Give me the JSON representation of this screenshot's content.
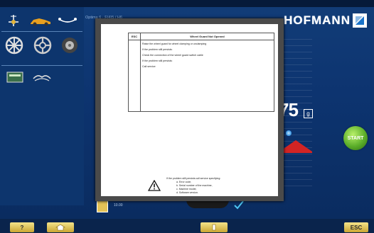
{
  "app": {
    "title_small": "Optima 6 · F(4)5 / H6",
    "brand": "HOFMANN"
  },
  "toolbar": {
    "icons": [
      "balance-icon",
      "car-icon",
      "axle-icon",
      "wheel-alloy-icon",
      "wheel-steel-icon",
      "tyre-icon",
      "display-icon",
      "cloud-icon"
    ]
  },
  "dialog": {
    "error_code_header": "ESC",
    "title": "Wheel Guard Not Opened",
    "steps": [
      "Raise the wheel guard for wheel clamping or unclamping",
      "If the problem still persists:",
      "Check the connection of the wheel guard switch cable",
      "If the problem still persists:",
      "Call service"
    ],
    "notice_text": "If the problem still persists call service specifying:",
    "notice_items": [
      "a.   Error code,",
      "b.   Serial number of the machine,",
      "c.   Machine model,",
      "d.   Software version."
    ]
  },
  "readout": {
    "weight": "75",
    "unit": "g"
  },
  "buttons": {
    "start": "START",
    "help": "?",
    "esc": "ESC"
  },
  "status": {
    "small_label": "10.00"
  },
  "colors": {
    "background": "#0d3470",
    "start_button": "#5caf2a",
    "footer_buttons": "#e4c85a",
    "red_indicator": "#d22424"
  }
}
